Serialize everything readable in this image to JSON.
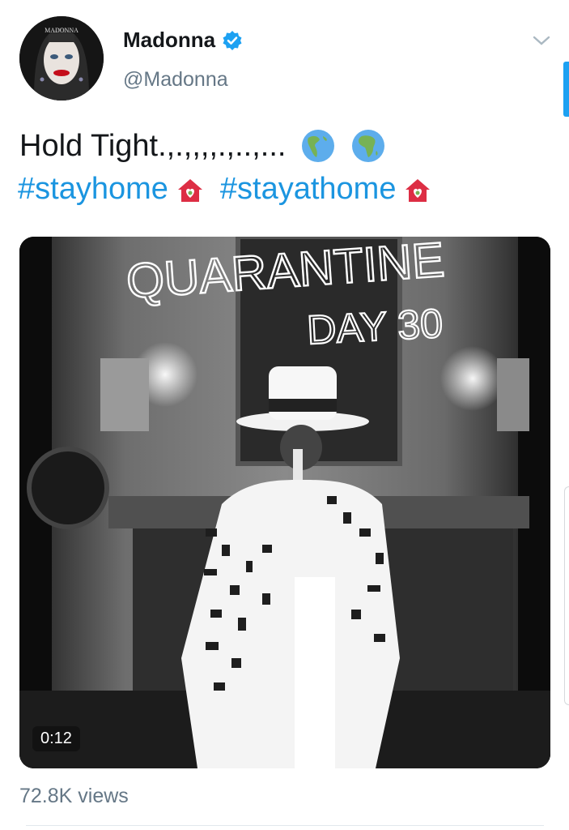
{
  "author": {
    "display_name": "Madonna",
    "handle": "@Madonna",
    "avatar_logo_text": "MADONNA"
  },
  "tweet": {
    "text": "Hold Tight.,.,,,,.,..,...",
    "hashtags": [
      "#stayhome",
      "#stayathome"
    ],
    "icons": [
      "globe-americas-icon",
      "globe-africa-icon",
      "house-with-heart-icon",
      "house-with-heart-icon"
    ]
  },
  "media": {
    "overlay_text_line1": "QUARANTINE",
    "overlay_text_line2": "DAY 30",
    "duration": "0:12"
  },
  "stats": {
    "views": "72.8K views"
  },
  "colors": {
    "link": "#1b95e0",
    "verified": "#1da1f2",
    "secondary_text": "#657786"
  }
}
